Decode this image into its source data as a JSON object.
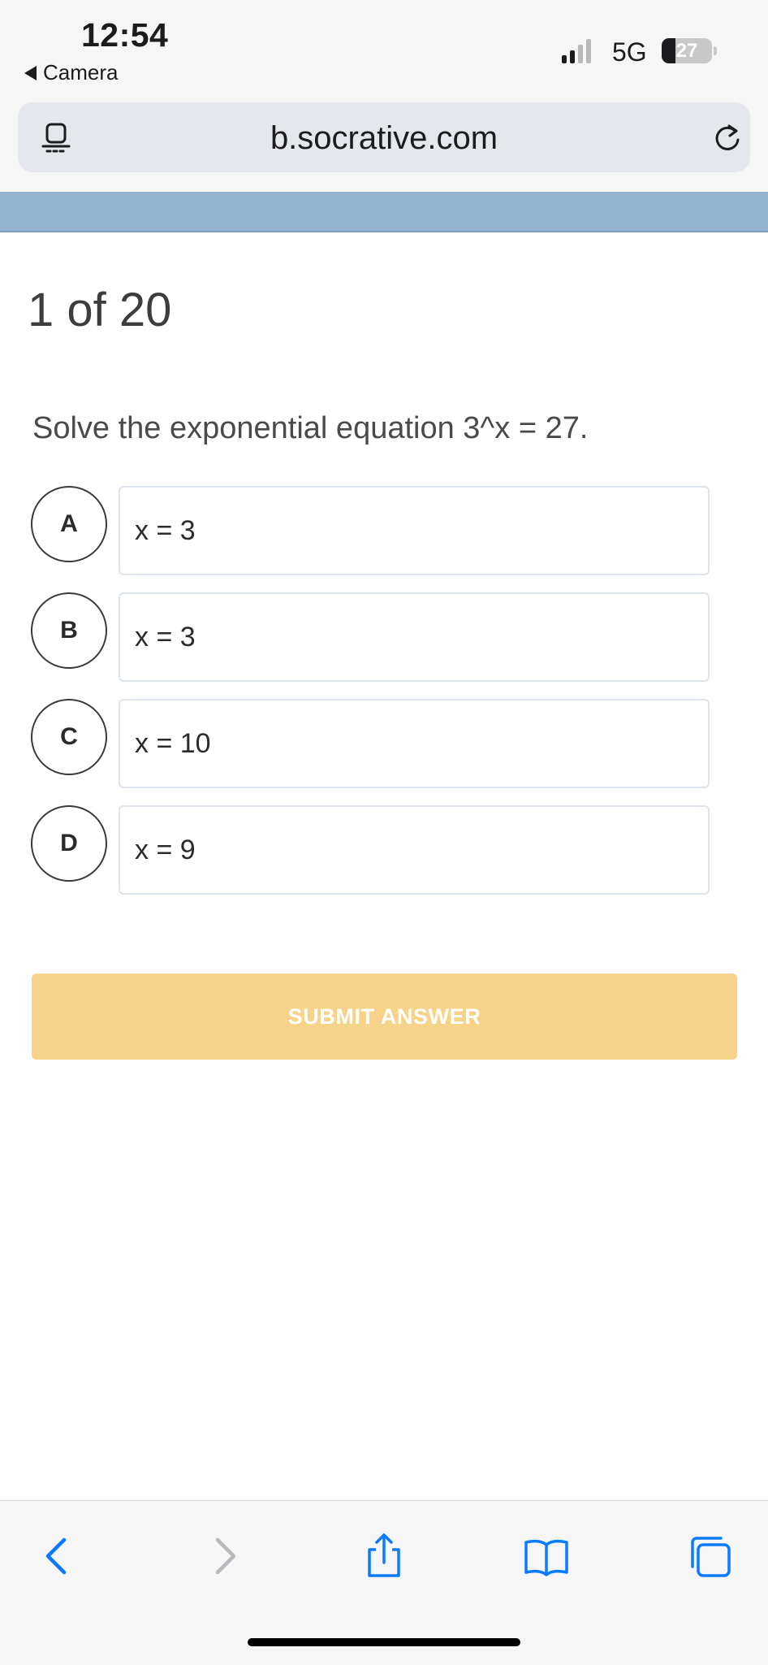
{
  "status_bar": {
    "time": "12:54",
    "back_app": "Camera",
    "network": "5G",
    "battery": "27",
    "signal_bars_active": 2,
    "signal_bars_total": 4,
    "battery_level": 0.27
  },
  "browser": {
    "url": "b.socrative.com",
    "left_icon": "reader-icon",
    "right_icon": "reload-icon"
  },
  "quiz": {
    "progress": "1 of 20",
    "question": "Solve the exponential equation 3^x = 27.",
    "answers": [
      {
        "letter": "A",
        "text": "x = 3"
      },
      {
        "letter": "B",
        "text": "x = 3"
      },
      {
        "letter": "C",
        "text": "x = 10"
      },
      {
        "letter": "D",
        "text": "x = 9"
      }
    ],
    "submit_label": "SUBMIT ANSWER"
  },
  "toolbar": {
    "icons": [
      "back-icon",
      "forward-icon",
      "share-icon",
      "bookmarks-icon",
      "tabs-icon"
    ]
  },
  "colors": {
    "header_strip": "#94b4cf",
    "submit_button": "#f6d389",
    "answer_border": "#dde3ec",
    "ios_blue": "#0a7aff"
  }
}
